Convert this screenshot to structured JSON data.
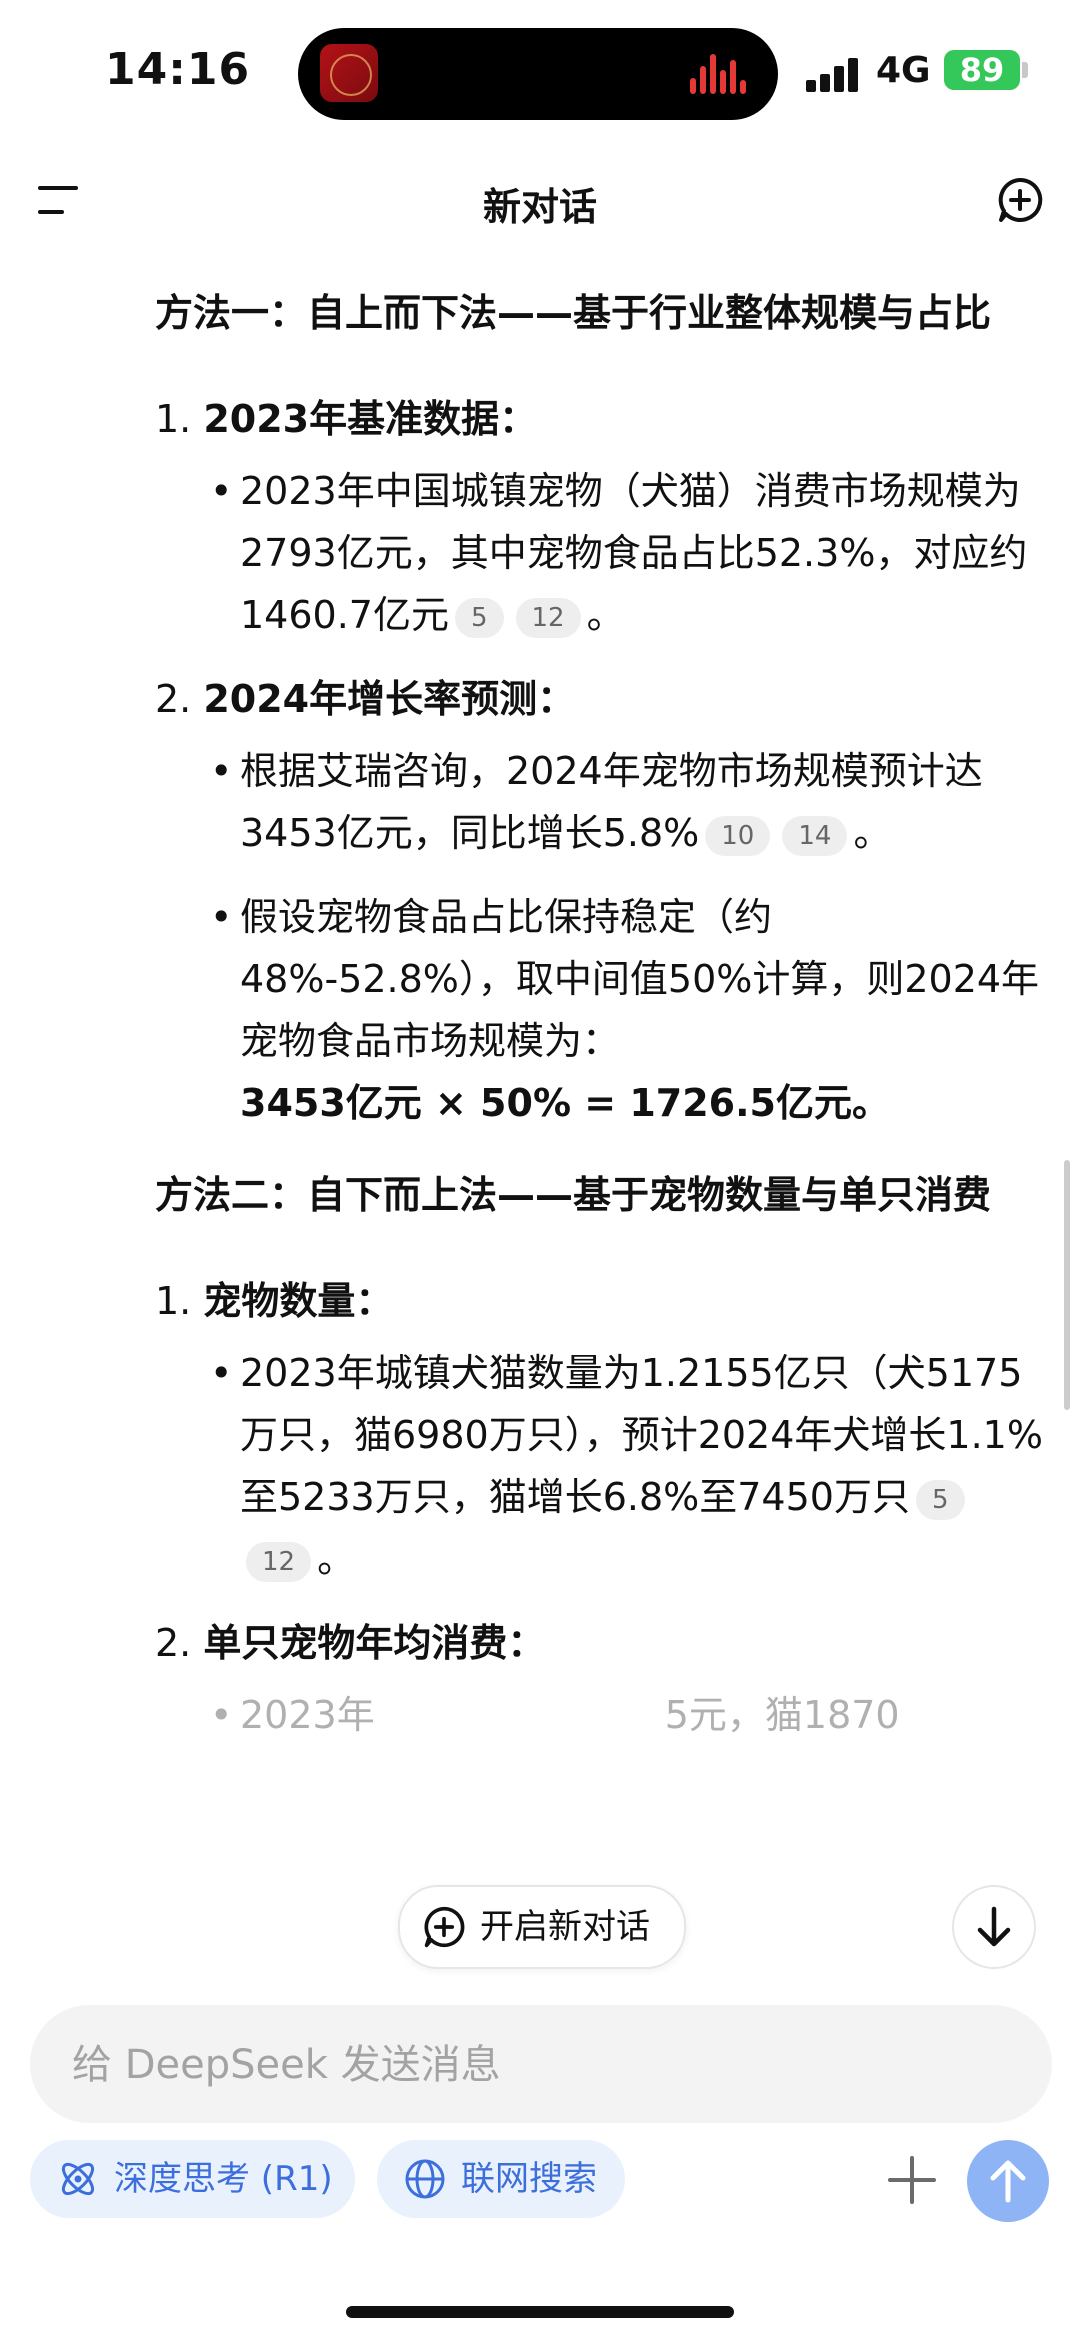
{
  "status_bar": {
    "time": "14:16",
    "network": "4G",
    "battery": "89"
  },
  "header": {
    "title": "新对话"
  },
  "content": {
    "method1": {
      "title": "方法一：自上而下法——基于行业整体规模与占比",
      "item1_num": "1.",
      "item1_label": "2023年基准数据：",
      "item1_bullet1": "2023年中国城镇宠物（犬猫）消费市场规模为2793亿元，其中宠物食品占比52.3%，对应约1460.7亿元",
      "item1_bullet1_cites": [
        "5",
        "12"
      ],
      "item1_bullet1_end": "。",
      "item2_num": "2.",
      "item2_label": "2024年增长率预测：",
      "item2_bullet1": "根据艾瑞咨询，2024年宠物市场规模预计达3453亿元，同比增长5.8%",
      "item2_bullet1_cites": [
        "10",
        "14"
      ],
      "item2_bullet1_end": "。",
      "item2_bullet2": "假设宠物食品占比保持稳定（约48%-52.8%），取中间值50%计算，则2024年宠物食品市场规模为：",
      "item2_bullet2_formula": "3453亿元 × 50% = 1726.5亿元。"
    },
    "method2": {
      "title": "方法二：自下而上法——基于宠物数量与单只消费",
      "item1_num": "1.",
      "item1_label": "宠物数量：",
      "item1_bullet1": "2023年城镇犬猫数量为1.2155亿只（犬5175万只，猫6980万只），预计2024年犬增长1.1%至5233万只，猫增长6.8%至7450万只",
      "item1_bullet1_cites": [
        "5",
        "12"
      ],
      "item1_bullet1_end": "。",
      "item2_num": "2.",
      "item2_label": "单只宠物年均消费：",
      "item2_bullet1_partial_a": "2023年",
      "item2_bullet1_partial_b": "5元，猫1870"
    }
  },
  "floating": {
    "new_chat_label": "开启新对话"
  },
  "input": {
    "placeholder": "给 DeepSeek 发送消息"
  },
  "toolbar": {
    "deep_think_label": "深度思考 (R1)",
    "web_search_label": "联网搜索"
  },
  "icons": {
    "menu": "menu-icon",
    "new_chat": "new-chat-icon",
    "atom": "atom-icon",
    "globe": "globe-icon",
    "plus": "plus-icon",
    "arrow_up": "arrow-up-icon",
    "arrow_down": "arrow-down-icon"
  },
  "colors": {
    "accent": "#3d6fdc",
    "chip_bg": "#e9f1fd",
    "send_bg": "#8fb4f5",
    "battery": "#34c759"
  }
}
